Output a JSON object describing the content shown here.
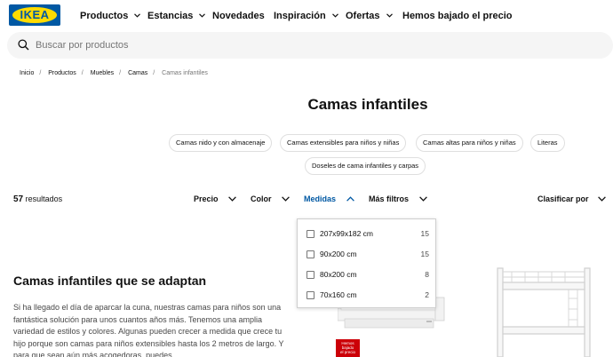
{
  "logo": {
    "text": "IKEA",
    "brand_blue": "#0058a3",
    "brand_yellow": "#ffdb00"
  },
  "nav": [
    {
      "label": "Productos",
      "has_dropdown": true
    },
    {
      "label": "Estancias",
      "has_dropdown": true
    },
    {
      "label": "Novedades",
      "has_dropdown": false
    },
    {
      "label": "Inspiración",
      "has_dropdown": true
    },
    {
      "label": "Ofertas",
      "has_dropdown": true
    },
    {
      "label": "Hemos bajado el precio",
      "has_dropdown": false
    }
  ],
  "search": {
    "placeholder": "Buscar por productos",
    "icon": "search-icon"
  },
  "breadcrumb": [
    "Inicio",
    "Productos",
    "Muebles",
    "Camas",
    "Camas infantiles"
  ],
  "page_title": "Camas infantiles",
  "categories": [
    "Camas nido y con almacenaje",
    "Camas extensibles para niños y niñas",
    "Camas altas para niños y niñas",
    "Literas",
    "Doseles de cama infantiles y carpas"
  ],
  "results": {
    "count": "57",
    "label": "resultados"
  },
  "filters": [
    {
      "label": "Precio",
      "expanded": false
    },
    {
      "label": "Color",
      "expanded": false
    },
    {
      "label": "Medidas",
      "expanded": true
    },
    {
      "label": "Más filtros",
      "expanded": false
    }
  ],
  "sort_label": "Clasificar por",
  "size_options": [
    {
      "label": "207x99x182 cm",
      "count": "15",
      "checked": false
    },
    {
      "label": "90x200 cm",
      "count": "15",
      "checked": false
    },
    {
      "label": "80x200 cm",
      "count": "8",
      "checked": false
    },
    {
      "label": "70x160 cm",
      "count": "2",
      "checked": false
    }
  ],
  "article": {
    "heading": "Camas infantiles que se adaptan",
    "body": "Si ha llegado el día de aparcar la cuna, nuestras camas para niños son una fantástica solución para unos cuantos años más. Tenemos una amplia variedad de estilos y colores. Algunas pueden crecer a medida que crece tu hijo porque son camas para niños extensibles hasta los 2 metros de largo. Y para que sean aún más acogedoras, puedes"
  },
  "badge": {
    "line1": "Hemos",
    "line2": "bajado",
    "line3": "el precio",
    "color": "#cc0008"
  },
  "colors": {
    "active_filter": "#0058a3",
    "text": "#111111",
    "muted": "#767676"
  }
}
